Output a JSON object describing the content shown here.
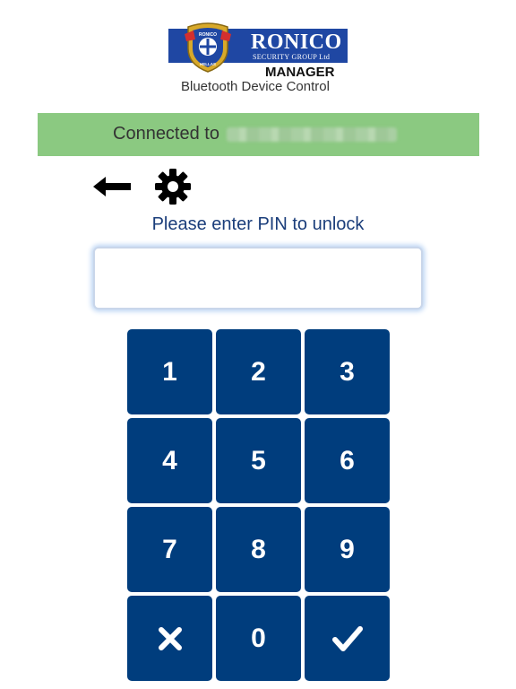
{
  "logo": {
    "title": "RONICO",
    "subtitle": "SECURITY GROUP Ltd",
    "shield_top": "RONICO",
    "shield_bottom": "HELLAS",
    "product": "MANAGER",
    "tagline": "Bluetooth Device Control"
  },
  "status": {
    "label": "Connected to",
    "color": "#8bc981"
  },
  "toolbar": {
    "back_icon": "arrow-left-icon",
    "settings_icon": "gear-icon"
  },
  "prompt": "Please enter PIN to unlock",
  "pin_input": {
    "value": "",
    "placeholder": ""
  },
  "keypad": {
    "color": "#003d7d",
    "keys": [
      "1",
      "2",
      "3",
      "4",
      "5",
      "6",
      "7",
      "8",
      "9",
      "clear-icon",
      "0",
      "check-icon"
    ]
  }
}
